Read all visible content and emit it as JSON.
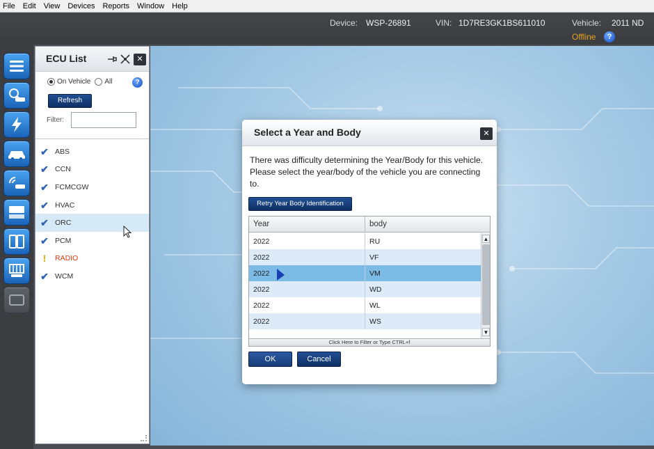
{
  "menu": {
    "items": [
      "File",
      "Edit",
      "View",
      "Devices",
      "Reports",
      "Window",
      "Help"
    ]
  },
  "status": {
    "device_label": "Device:",
    "device_value": "WSP-26891",
    "vin_label": "VIN:",
    "vin_value": "1D7RE3GK1BS611010",
    "vehicle_label": "Vehicle:",
    "vehicle_value": "2011 ND",
    "connection": "Offline",
    "help_glyph": "?"
  },
  "rail": {
    "icons": [
      "menu-icon",
      "vehicle-scan-icon",
      "flash-icon",
      "car-icon",
      "wireless-car-icon",
      "vehicle-info-icon",
      "panels-icon",
      "network-icon",
      "disabled-module-icon"
    ]
  },
  "ecu_panel": {
    "title": "ECU List",
    "close_glyph": "✕",
    "radio_on_vehicle": "On Vehicle",
    "radio_all": "All",
    "help_glyph": "?",
    "refresh_label": "Refresh",
    "filter_label": "Filter:",
    "filter_value": "",
    "items": [
      {
        "name": "ABS",
        "status": "ok"
      },
      {
        "name": "CCN",
        "status": "ok"
      },
      {
        "name": "FCMCGW",
        "status": "ok"
      },
      {
        "name": "HVAC",
        "status": "ok"
      },
      {
        "name": "ORC",
        "status": "ok"
      },
      {
        "name": "PCM",
        "status": "ok"
      },
      {
        "name": "RADIO",
        "status": "warning"
      },
      {
        "name": "WCM",
        "status": "ok"
      }
    ],
    "check_glyph": "✔",
    "warn_glyph": "!"
  },
  "dialog": {
    "title": "Select a Year and Body",
    "close_glyph": "✕",
    "message": "There was difficulty determining the Year/Body for this vehicle. Please select the year/body of the vehicle you are connecting to.",
    "retry_label": "Retry Year Body Identification",
    "columns": [
      "Year",
      "body"
    ],
    "rows": [
      {
        "year": "2022",
        "body": "RU"
      },
      {
        "year": "2022",
        "body": "VF"
      },
      {
        "year": "2022",
        "body": "VM"
      },
      {
        "year": "2022",
        "body": "WD"
      },
      {
        "year": "2022",
        "body": "WL"
      },
      {
        "year": "2022",
        "body": "WS"
      }
    ],
    "selected_body": "VM",
    "filter_hint": "Click Here to Filter or Type CTRL+f",
    "ok_label": "OK",
    "cancel_label": "Cancel",
    "scroll_up_glyph": "▲",
    "scroll_down_glyph": "▼"
  },
  "colors": {
    "accent": "#1a3f7a",
    "offline": "#e9a21c",
    "warning_text": "#e03a12",
    "check": "#2f63b5",
    "selection": "#7cbbe6"
  }
}
